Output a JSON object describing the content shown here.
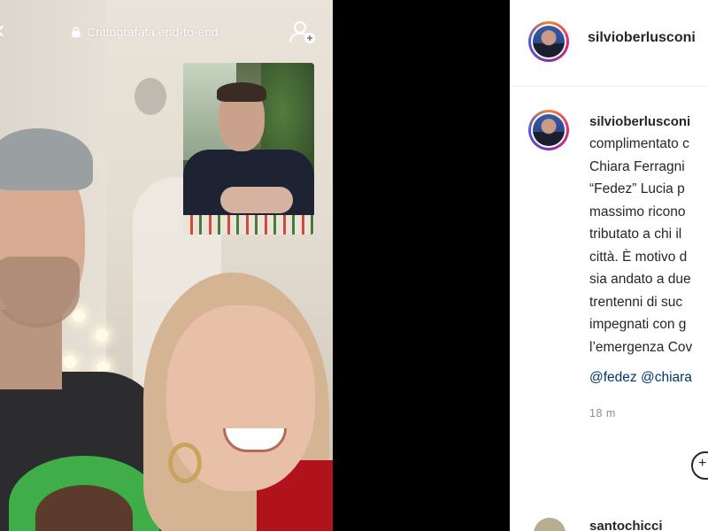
{
  "call": {
    "encryption_label": "Crittografata end-to-end"
  },
  "post": {
    "username": "silvioberlusconi",
    "caption_user": "silvioberlusconi",
    "caption_lines": [
      "complimentato c",
      "Chiara Ferragni",
      "“Fedez” Lucia p",
      "massimo ricono",
      "tributato a chi il",
      "città. È motivo d",
      "sia andato a due",
      "trentenni di suc",
      "impegnati con g",
      "l’emergenza Cov"
    ],
    "mentions": "@fedez @chiara",
    "time": "18 m",
    "comment_user": "santochicci"
  },
  "icons": {
    "back": "chevron-left-icon",
    "lock": "lock-icon",
    "add_person": "add-person-icon",
    "plus": "plus-circle-icon"
  },
  "colors": {
    "mention": "#00376b",
    "black_gap": "#000000",
    "muted": "#8e8e8e"
  }
}
